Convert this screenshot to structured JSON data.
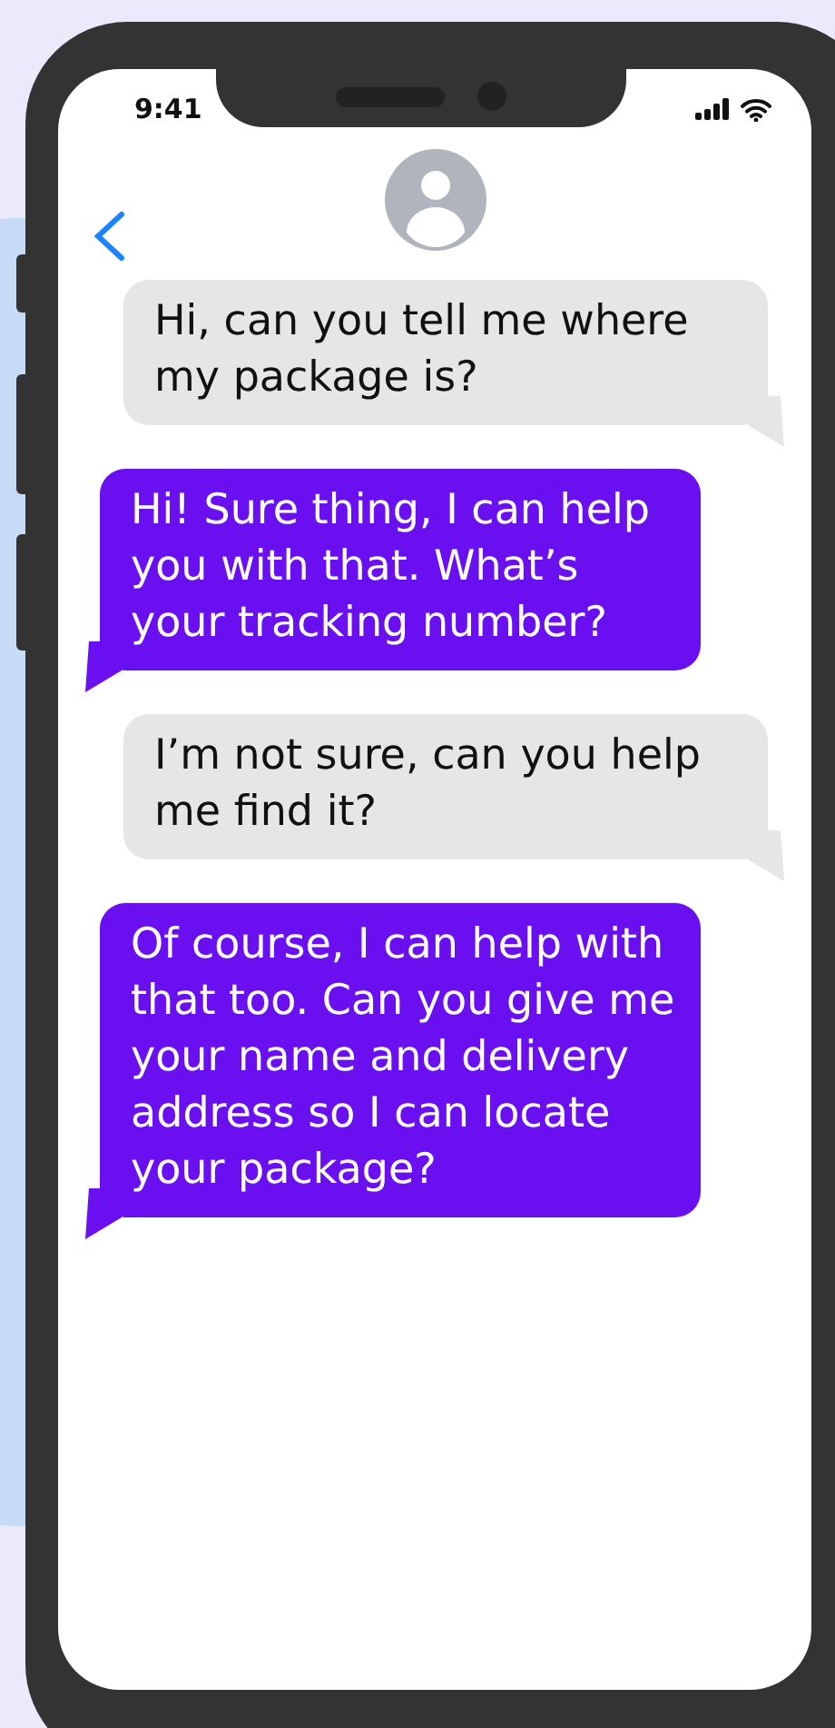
{
  "status_bar": {
    "time": "9:41"
  },
  "messages": [
    {
      "kind": "received",
      "text": "Hi, can you tell me where my package is?"
    },
    {
      "kind": "sent",
      "text": "Hi! Sure thing, I can help you with that. What’s your tracking number?"
    },
    {
      "kind": "received",
      "text": "I’m not sure, can you help me find it?"
    },
    {
      "kind": "sent",
      "text": "Of course, I can help with that too. Can you give me your name and delivery address so I can locate your package?"
    }
  ]
}
